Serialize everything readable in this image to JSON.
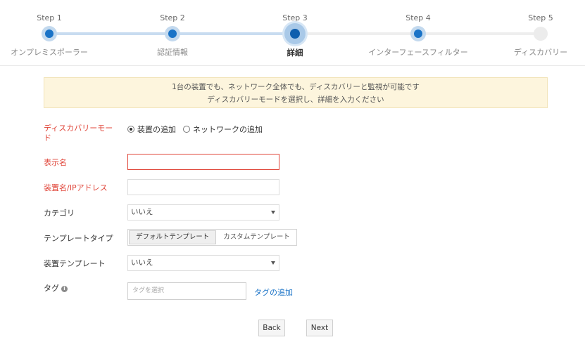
{
  "stepper": {
    "steps": [
      {
        "label": "Step 1",
        "name": "オンプレミスポーラー",
        "state": "done"
      },
      {
        "label": "Step 2",
        "name": "認証情報",
        "state": "done"
      },
      {
        "label": "Step 3",
        "name": "詳細",
        "state": "current"
      },
      {
        "label": "Step 4",
        "name": "インターフェースフィルター",
        "state": "done"
      },
      {
        "label": "Step 5",
        "name": "ディスカバリー",
        "state": "todo"
      }
    ]
  },
  "notice": {
    "line1": "1台の装置でも、ネットワーク全体でも、ディスカバリーと監視が可能です",
    "line2": "ディスカバリーモードを選択し、詳細を入力ください"
  },
  "form": {
    "discovery_mode_label": "ディスカバリーモード",
    "discovery_options": [
      {
        "label": "装置の追加",
        "selected": true
      },
      {
        "label": "ネットワークの追加",
        "selected": false
      }
    ],
    "display_name_label": "表示名",
    "display_name_value": "",
    "device_name_label": "装置名/IPアドレス",
    "device_name_value": "",
    "category_label": "カテゴリ",
    "category_value": "いいえ",
    "template_type_label": "テンプレートタイプ",
    "template_type_options": [
      "デフォルトテンプレート",
      "カスタムテンプレート"
    ],
    "device_template_label": "装置テンプレート",
    "device_template_value": "いいえ",
    "tag_label": "タグ",
    "tag_placeholder": "タグを選択",
    "tag_add_label": "タグの追加"
  },
  "actions": {
    "back_label": "Back",
    "next_label": "Next"
  },
  "colors": {
    "accent": "#1a73c7",
    "required": "#e0463a",
    "notice_bg": "#fdf5dd"
  }
}
